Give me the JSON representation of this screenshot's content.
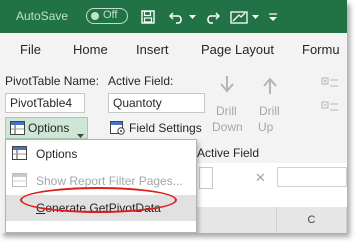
{
  "titlebar": {
    "autosave_label": "AutoSave",
    "autosave_state": "Off"
  },
  "tabs": [
    {
      "label": "File"
    },
    {
      "label": "Home"
    },
    {
      "label": "Insert"
    },
    {
      "label": "Page Layout"
    },
    {
      "label": "Formu"
    }
  ],
  "pivottable": {
    "name_label": "PivotTable Name:",
    "name_value": "PivotTable4",
    "options_label": "Options"
  },
  "active_field": {
    "label": "Active Field:",
    "value": "Quantoty",
    "field_settings_label": "Field Settings",
    "group_label": "Active Field",
    "drill_down_line1": "Drill",
    "drill_down_line2": "Down",
    "drill_up_line1": "Drill",
    "drill_up_line2": "Up"
  },
  "options_menu": {
    "items": [
      {
        "label": "Options",
        "enabled": true
      },
      {
        "label": "Show Report Filter Pages...",
        "enabled": false
      },
      {
        "label_underlined": "G",
        "label_rest": "enerate GetPivotData",
        "enabled": true,
        "highlighted": true
      }
    ]
  },
  "sheet": {
    "col_header": "C",
    "cancel_symbol": "✕"
  },
  "colors": {
    "excel_green": "#217346",
    "highlight_circle": "#e01d1d"
  }
}
